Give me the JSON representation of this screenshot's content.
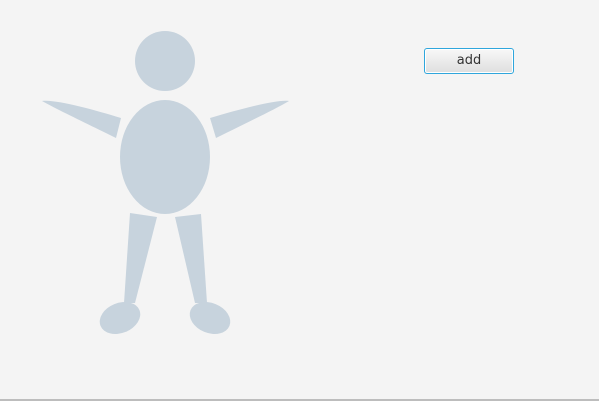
{
  "colors": {
    "background": "#f4f4f4",
    "figure_fill": "#c7d3dd",
    "button_border": "#2fa6dc",
    "button_text": "#333333"
  },
  "toolbar": {
    "add_label": "add"
  },
  "figure": {
    "icon": "person-silhouette-icon"
  }
}
